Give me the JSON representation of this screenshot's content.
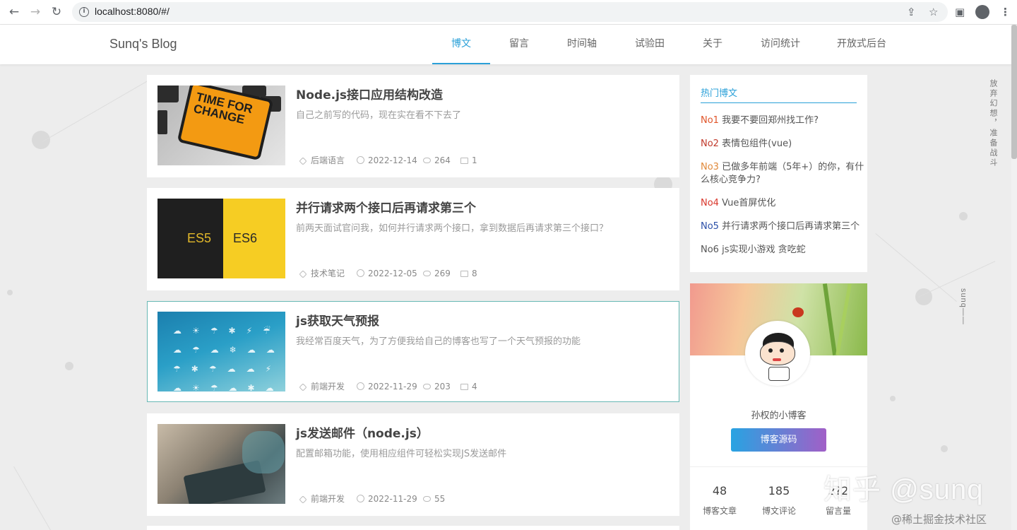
{
  "browser": {
    "url": "localhost:8080/#/",
    "back_glyph": "←",
    "forward_glyph": "→",
    "reload_glyph": "↻"
  },
  "site": {
    "logo": "Sunq's Blog",
    "menu": [
      "博文",
      "留言",
      "时间轴",
      "试验田",
      "关于",
      "访问统计",
      "开放式后台"
    ],
    "active_menu": 0,
    "accent_color": "#2aa0d8"
  },
  "articles": [
    {
      "title": "Node.js接口应用结构改造",
      "desc": "自己之前写的代码，现在实在看不下去了",
      "category": "后端语言",
      "date": "2022-12-14",
      "views": "264",
      "comments": "1",
      "thumb_text": "TIME FOR CHANGE"
    },
    {
      "title": "并行请求两个接口后再请求第三个",
      "desc": "前两天面试官问我，如何并行请求两个接口，拿到数据后再请求第三个接口？",
      "category": "技术笔记",
      "date": "2022-12-05",
      "views": "269",
      "comments": "8",
      "thumb_left": "ES5",
      "thumb_right": "ES6"
    },
    {
      "title": "js获取天气预报",
      "desc": "我经常百度天气，为了方便我给自己的博客也写了一个天气预报的功能",
      "category": "前端开发",
      "date": "2022-11-29",
      "views": "203",
      "comments": "4"
    },
    {
      "title": "js发送邮件（node.js）",
      "desc": "配置邮箱功能，使用相应组件可轻松实现JS发送邮件",
      "category": "前端开发",
      "date": "2022-11-29",
      "views": "55"
    }
  ],
  "hot": {
    "title": "热门博文",
    "items": [
      {
        "rank": "No1",
        "text": "我要不要回郑州找工作?",
        "color": "#e0552a"
      },
      {
        "rank": "No2",
        "text": "表情包组件(vue)",
        "color": "#c0392b"
      },
      {
        "rank": "No3",
        "text": "已做多年前端（5年+）的你，有什么核心竞争力?",
        "color": "#e0893a"
      },
      {
        "rank": "No4",
        "text": "Vue首屏优化",
        "color": "#d9362b"
      },
      {
        "rank": "No5",
        "text": "并行请求两个接口后再请求第三个",
        "color": "#2b4fa8"
      },
      {
        "rank": "No6",
        "text": "js实现小游戏 贪吃蛇",
        "color": "#555555"
      }
    ]
  },
  "profile": {
    "name": "孙权的小博客",
    "button": "博客源码",
    "stats": [
      {
        "num": "48",
        "label": "博客文章"
      },
      {
        "num": "185",
        "label": "博文评论"
      },
      {
        "num": "2?2",
        "label": "留言量"
      }
    ]
  },
  "side_text": {
    "motto": "放弃幻想，准备战斗",
    "sign": "sunq——"
  },
  "watermark": {
    "main": "知乎 @sunq",
    "sub": "@稀土掘金技术社区"
  }
}
